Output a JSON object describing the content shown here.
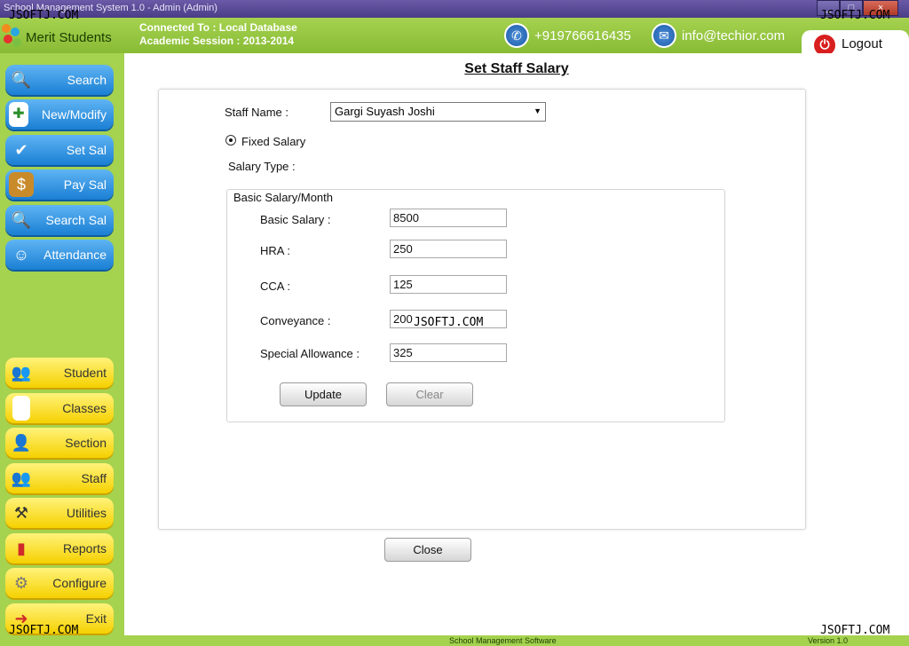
{
  "window": {
    "title": "School Management System 1.0  -  Admin (Admin)",
    "controls": [
      "_",
      "□",
      "×"
    ]
  },
  "header": {
    "app_name": "Merit Students",
    "connected_to": "Connected To : Local Database",
    "academic_session": "Academic Session : 2013-2014",
    "phone": "+919766616435",
    "email": "info@techior.com",
    "logout_label": "Logout"
  },
  "sidebar": {
    "top_items": [
      {
        "label": "Search",
        "icon": "magnifier-icon"
      },
      {
        "label": "New/Modify",
        "icon": "new-document-icon"
      },
      {
        "label": "Set Sal",
        "icon": "money-check-icon"
      },
      {
        "label": "Pay Sal",
        "icon": "cash-icon"
      },
      {
        "label": "Search Sal",
        "icon": "search-money-icon"
      },
      {
        "label": "Attendance",
        "icon": "attendance-icon"
      }
    ],
    "bottom_items": [
      {
        "label": "Student",
        "icon": "students-icon"
      },
      {
        "label": "Classes",
        "icon": "document-icon"
      },
      {
        "label": "Section",
        "icon": "section-icon"
      },
      {
        "label": "Staff",
        "icon": "staff-icon"
      },
      {
        "label": "Utilities",
        "icon": "utilities-icon"
      },
      {
        "label": "Reports",
        "icon": "reports-icon"
      },
      {
        "label": "Configure",
        "icon": "gear-icon"
      },
      {
        "label": "Exit",
        "icon": "exit-door-icon"
      }
    ]
  },
  "main": {
    "title": "Set Staff Salary",
    "staff_name_label": "Staff Name :",
    "staff_name_value": "Gargi Suyash Joshi",
    "fixed_salary_label": "Fixed Salary",
    "salary_type_label": "Salary Type :",
    "group_label": "Basic Salary/Month",
    "fields": [
      {
        "label": "Basic Salary :",
        "value": "8500"
      },
      {
        "label": "HRA :",
        "value": "250"
      },
      {
        "label": "CCA :",
        "value": "125"
      },
      {
        "label": "Conveyance :",
        "value": "200"
      },
      {
        "label": "Special Allowance :",
        "value": "325"
      }
    ],
    "update_label": "Update",
    "clear_label": "Clear",
    "close_label": "Close"
  },
  "statusbar": {
    "text": "School Management Software",
    "version": "Version 1.0"
  },
  "watermarks": [
    "JSOFTJ.COM",
    "JSOFTJ.COM",
    "JSOFTJ.COM",
    "JSOFTJ.COM",
    "JSOFTJ.COM"
  ]
}
